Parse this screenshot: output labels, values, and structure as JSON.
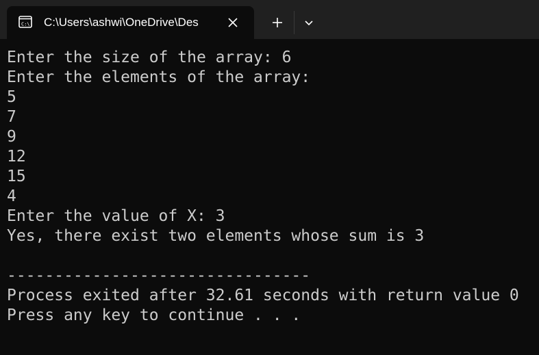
{
  "window": {
    "tab_title": "C:\\Users\\ashwi\\OneDrive\\Des",
    "tab_icon": "terminal-icon",
    "close_icon": "close-icon",
    "new_tab_icon": "plus-icon",
    "dropdown_icon": "chevron-down-icon",
    "icon_text": "C:\\"
  },
  "console": {
    "lines": [
      "Enter the size of the array: 6",
      "Enter the elements of the array:",
      "5",
      "7",
      "9",
      "12",
      "15",
      "4",
      "Enter the value of X: 3",
      "Yes, there exist two elements whose sum is 3",
      "",
      "--------------------------------",
      "Process exited after 32.61 seconds with return value 0",
      "Press any key to continue . . ."
    ]
  },
  "colors": {
    "terminal_background": "#0c0c0c",
    "titlebar_background": "#202020",
    "text": "#cccccc",
    "tab_text": "#ffffff"
  }
}
